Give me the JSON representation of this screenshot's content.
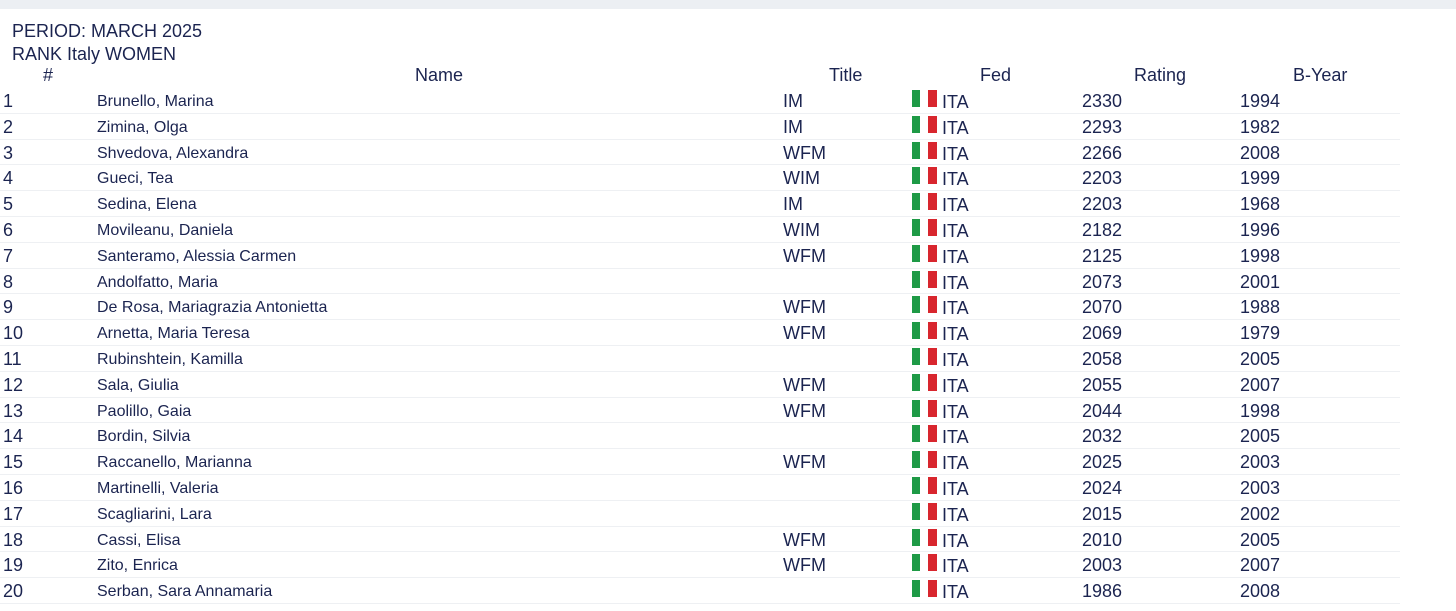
{
  "period_label": "PERIOD: MARCH 2025",
  "rank_label": "RANK Italy WOMEN",
  "columns": {
    "rank": "#",
    "name": "Name",
    "title": "Title",
    "fed": "Fed",
    "rating": "Rating",
    "byear": "B-Year"
  },
  "flag_icon": "italy-flag-icon",
  "colors": {
    "text": "#1b2450",
    "flag_green": "#1e9a46",
    "flag_white": "#ffffff",
    "flag_red": "#d8262e"
  },
  "rows": [
    {
      "rank": "1",
      "name": "Brunello, Marina",
      "title": "IM",
      "fed": "ITA",
      "rating": "2330",
      "byear": "1994"
    },
    {
      "rank": "2",
      "name": "Zimina, Olga",
      "title": "IM",
      "fed": "ITA",
      "rating": "2293",
      "byear": "1982"
    },
    {
      "rank": "3",
      "name": "Shvedova, Alexandra",
      "title": "WFM",
      "fed": "ITA",
      "rating": "2266",
      "byear": "2008"
    },
    {
      "rank": "4",
      "name": "Gueci, Tea",
      "title": "WIM",
      "fed": "ITA",
      "rating": "2203",
      "byear": "1999"
    },
    {
      "rank": "5",
      "name": "Sedina, Elena",
      "title": "IM",
      "fed": "ITA",
      "rating": "2203",
      "byear": "1968"
    },
    {
      "rank": "6",
      "name": "Movileanu, Daniela",
      "title": "WIM",
      "fed": "ITA",
      "rating": "2182",
      "byear": "1996"
    },
    {
      "rank": "7",
      "name": "Santeramo, Alessia Carmen",
      "title": "WFM",
      "fed": "ITA",
      "rating": "2125",
      "byear": "1998"
    },
    {
      "rank": "8",
      "name": "Andolfatto, Maria",
      "title": "",
      "fed": "ITA",
      "rating": "2073",
      "byear": "2001"
    },
    {
      "rank": "9",
      "name": "De Rosa, Mariagrazia Antonietta",
      "title": "WFM",
      "fed": "ITA",
      "rating": "2070",
      "byear": "1988"
    },
    {
      "rank": "10",
      "name": "Arnetta, Maria Teresa",
      "title": "WFM",
      "fed": "ITA",
      "rating": "2069",
      "byear": "1979"
    },
    {
      "rank": "11",
      "name": "Rubinshtein, Kamilla",
      "title": "",
      "fed": "ITA",
      "rating": "2058",
      "byear": "2005"
    },
    {
      "rank": "12",
      "name": "Sala, Giulia",
      "title": "WFM",
      "fed": "ITA",
      "rating": "2055",
      "byear": "2007"
    },
    {
      "rank": "13",
      "name": "Paolillo, Gaia",
      "title": "WFM",
      "fed": "ITA",
      "rating": "2044",
      "byear": "1998"
    },
    {
      "rank": "14",
      "name": "Bordin, Silvia",
      "title": "",
      "fed": "ITA",
      "rating": "2032",
      "byear": "2005"
    },
    {
      "rank": "15",
      "name": "Raccanello, Marianna",
      "title": "WFM",
      "fed": "ITA",
      "rating": "2025",
      "byear": "2003"
    },
    {
      "rank": "16",
      "name": "Martinelli, Valeria",
      "title": "",
      "fed": "ITA",
      "rating": "2024",
      "byear": "2003"
    },
    {
      "rank": "17",
      "name": "Scagliarini, Lara",
      "title": "",
      "fed": "ITA",
      "rating": "2015",
      "byear": "2002"
    },
    {
      "rank": "18",
      "name": "Cassi, Elisa",
      "title": "WFM",
      "fed": "ITA",
      "rating": "2010",
      "byear": "2005"
    },
    {
      "rank": "19",
      "name": "Zito, Enrica",
      "title": "WFM",
      "fed": "ITA",
      "rating": "2003",
      "byear": "2007"
    },
    {
      "rank": "20",
      "name": "Serban, Sara Annamaria",
      "title": "",
      "fed": "ITA",
      "rating": "1986",
      "byear": "2008"
    }
  ]
}
